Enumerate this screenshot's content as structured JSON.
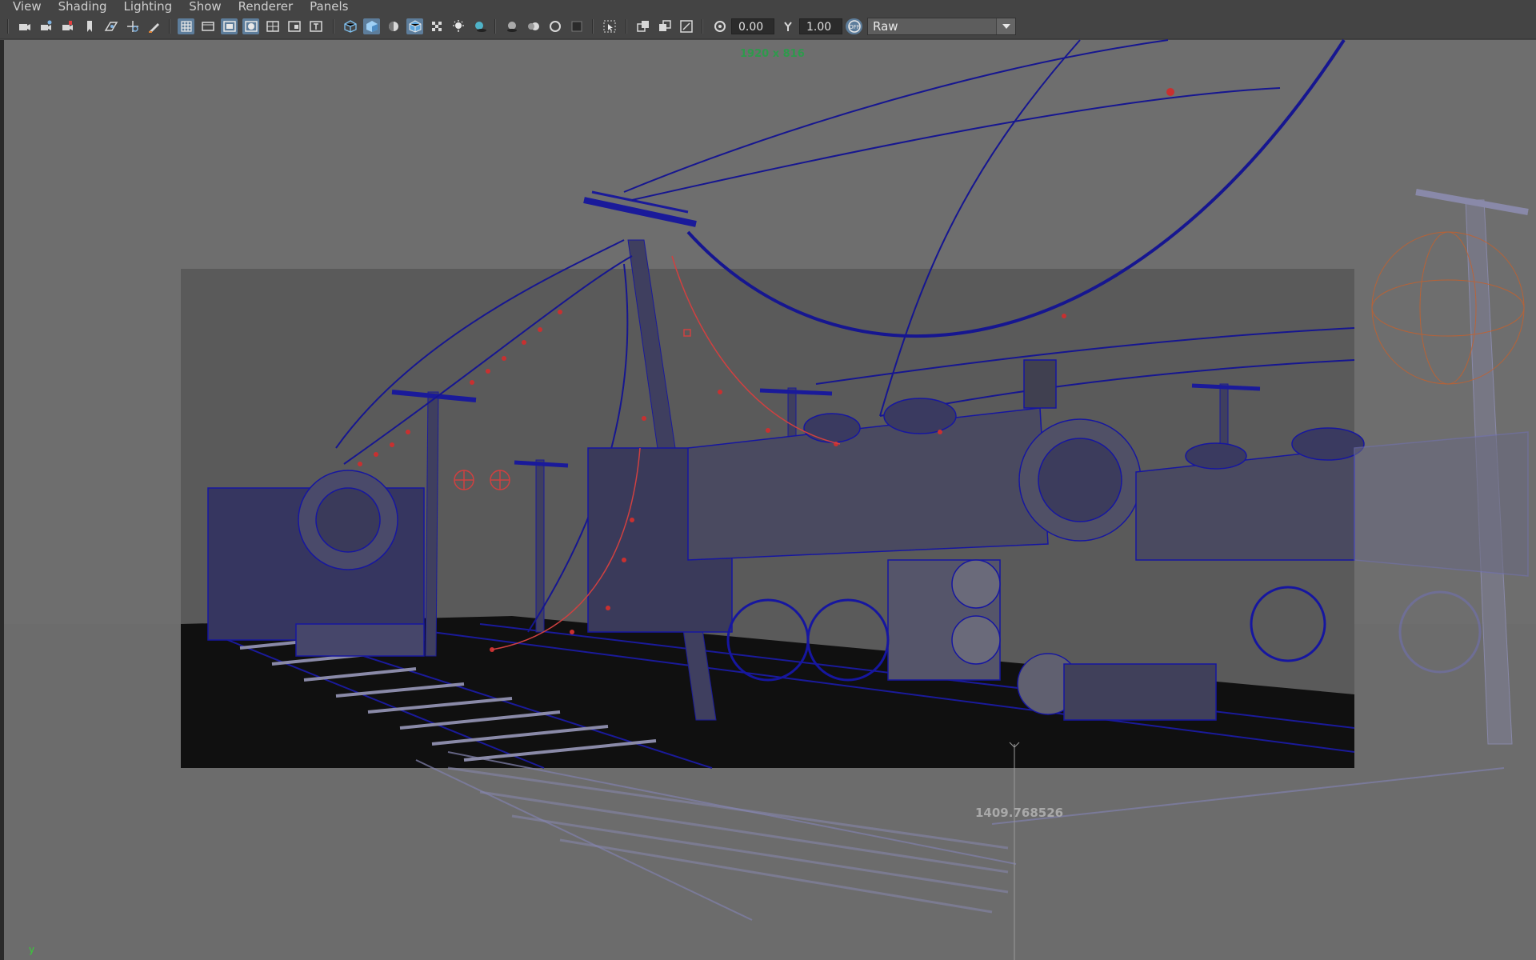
{
  "menubar": {
    "items": [
      "View",
      "Shading",
      "Lighting",
      "Show",
      "Renderer",
      "Panels"
    ]
  },
  "toolbar": {
    "exposure_value": "0.00",
    "gamma_value": "1.00",
    "color_space": "Raw",
    "icons": [
      "camera-icon",
      "camera-attributes-icon",
      "bookmark-camera-icon",
      "bookmark-icon",
      "image-plane-icon",
      "2d-pan-zoom-icon",
      "grease-pencil-icon",
      "grid-icon",
      "film-gate-icon",
      "resolution-gate-icon",
      "gate-mask-icon",
      "field-chart-icon",
      "safe-action-icon",
      "safe-title-icon",
      "wireframe-icon",
      "smooth-shade-icon",
      "default-material-icon",
      "wireframe-on-shaded-icon",
      "textured-icon",
      "use-all-lights-icon",
      "shadows-icon",
      "screen-space-ao-icon",
      "motion-blur-icon",
      "anti-aliasing-icon",
      "depth-of-field-icon",
      "isolate-select-icon",
      "xray-icon",
      "xray-active-components-icon",
      "xray-joints-icon",
      "exposure-icon",
      "gamma-icon",
      "view-transform-icon"
    ]
  },
  "viewport": {
    "resolution": "1920 x 816",
    "distance_readout": "1409.768526",
    "axis_label": "y",
    "colors": {
      "background": "#6e6e6e",
      "gate_mask": "#767676",
      "render_region_bg": "#5a5a5a",
      "ground": "#111111",
      "wireframe": "#0d0d80",
      "selection": "#c03030",
      "resolution_text": "#2e9a4c"
    }
  }
}
